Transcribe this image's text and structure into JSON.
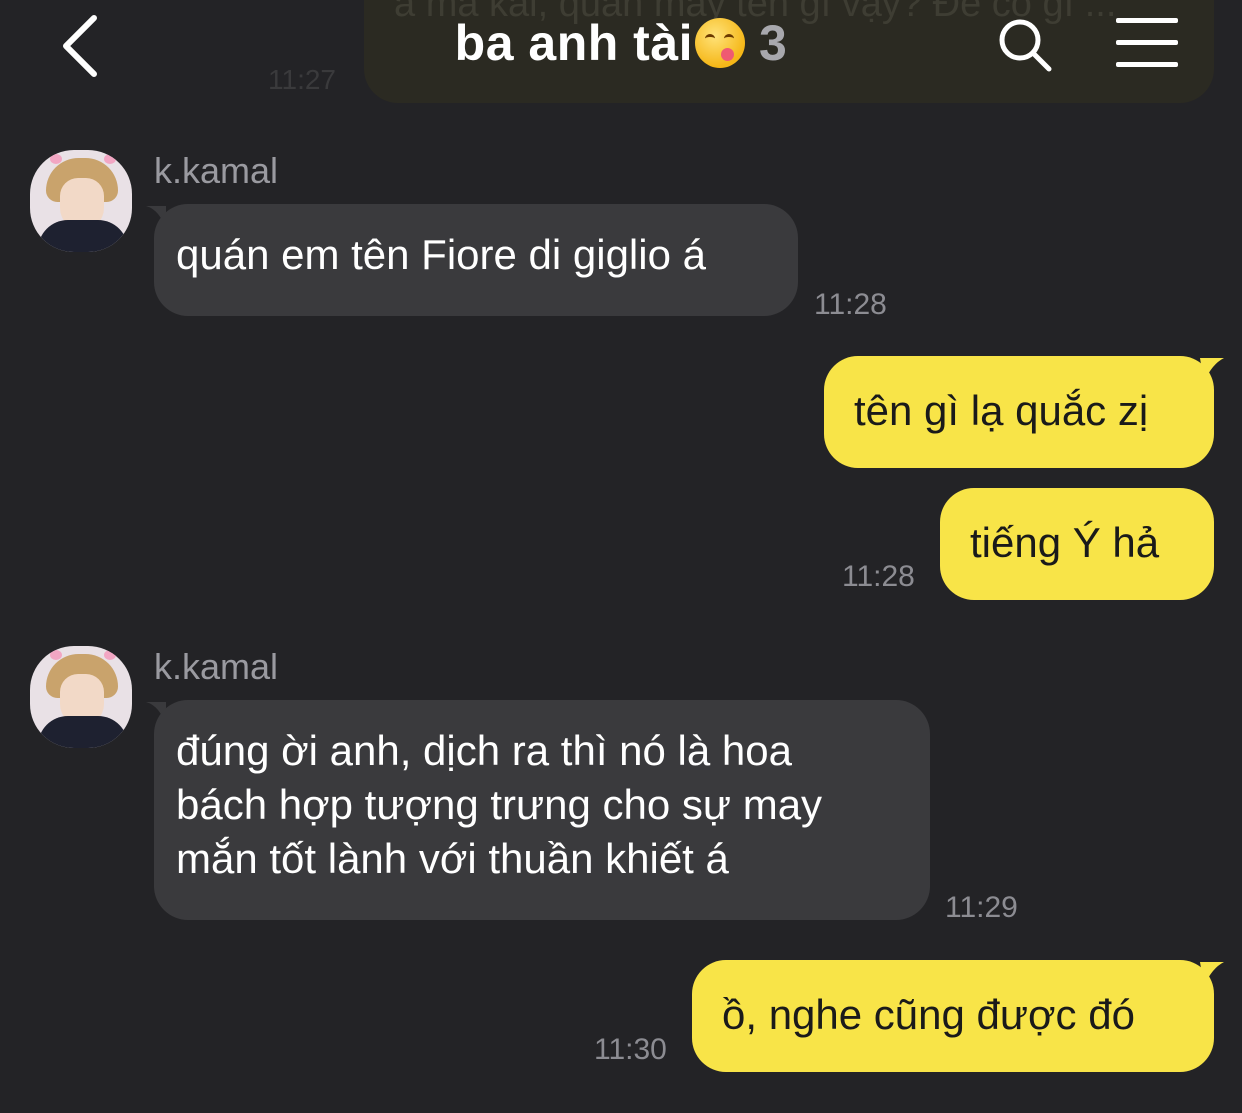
{
  "header": {
    "title": "ba anh tài",
    "emoji": "😋",
    "member_count": "3",
    "back_icon": "chevron-left-icon",
    "search_icon": "search-icon",
    "menu_icon": "hamburger-menu-icon"
  },
  "previous_message": {
    "partial_text": "á mà kai, quán mày tên gì vậy? Để có gì ... ",
    "time": "11:27"
  },
  "messages": [
    {
      "sender": "k.kamal",
      "direction": "incoming",
      "text": "quán em tên Fiore di giglio á",
      "time": "11:28"
    },
    {
      "direction": "outgoing",
      "text": "tên gì lạ quắc zị"
    },
    {
      "direction": "outgoing",
      "text": "tiếng Ý hả",
      "time": "11:28"
    },
    {
      "sender": "k.kamal",
      "direction": "incoming",
      "lines": [
        "đúng ời anh, dịch ra thì nó là hoa",
        "bách hợp tượng trưng cho sự may",
        "mắn tốt lành với thuần khiết á"
      ],
      "time": "11:29"
    },
    {
      "direction": "outgoing",
      "text": "ồ, nghe cũng được đó",
      "time": "11:30"
    }
  ],
  "colors": {
    "background": "#232326",
    "incoming_bubble": "#3a3a3d",
    "outgoing_bubble": "#f8e448"
  }
}
